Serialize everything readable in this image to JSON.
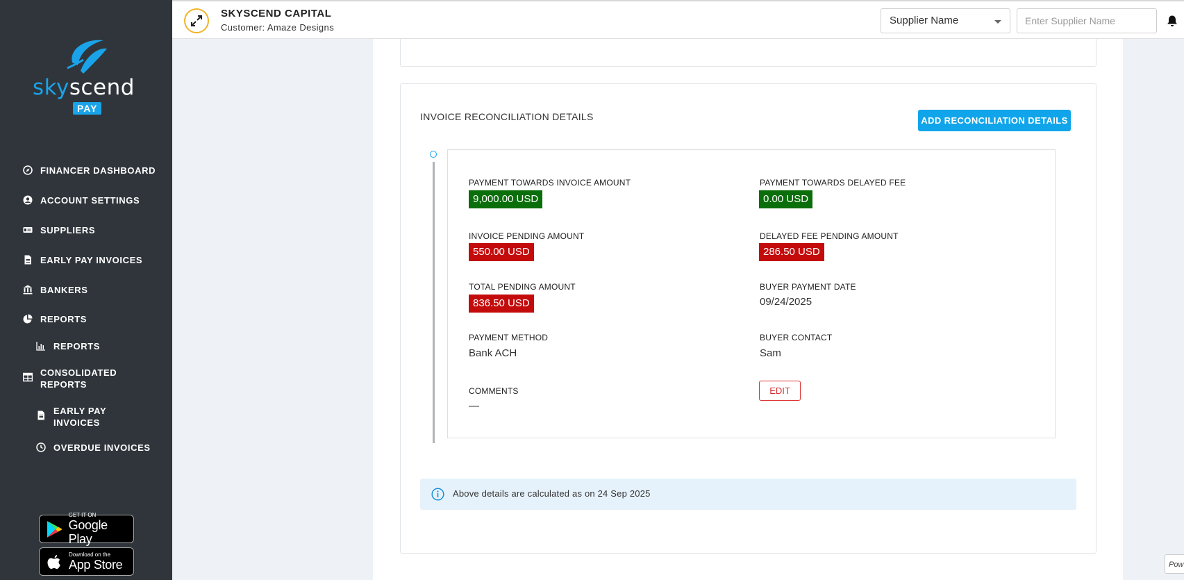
{
  "sidebar": {
    "logo": {
      "sky": "sky",
      "scend": "scend",
      "pay": "PAY"
    },
    "nav": [
      {
        "label": "FINANCER DASHBOARD",
        "icon": "compass-icon"
      },
      {
        "label": "ACCOUNT SETTINGS",
        "icon": "user-circle-icon"
      },
      {
        "label": "SUPPLIERS",
        "icon": "id-card-icon"
      },
      {
        "label": "EARLY PAY INVOICES",
        "icon": "document-icon"
      },
      {
        "label": "BANKERS",
        "icon": "bank-icon"
      },
      {
        "label": "REPORTS",
        "icon": "pie-chart-icon"
      },
      {
        "label": "REPORTS",
        "icon": "bar-chart-icon"
      },
      {
        "label": "CONSOLIDATED REPORTS",
        "icon": "table-icon"
      },
      {
        "label": "EARLY PAY INVOICES",
        "icon": "document-icon"
      },
      {
        "label": "OVERDUE INVOICES",
        "icon": "clock-icon"
      }
    ],
    "google_play": {
      "small": "GET IT ON",
      "big": "Google Play"
    },
    "app_store": {
      "small": "Download on the",
      "big": "App Store"
    }
  },
  "header": {
    "company_name": "SKYSCEND CAPITAL",
    "customer": "Customer: Amaze Designs",
    "select_value": "Supplier Name",
    "search_placeholder": "Enter Supplier Name"
  },
  "reconciliation": {
    "title": "INVOICE RECONCILIATION DETAILS",
    "add_button": "ADD RECONCILIATION DETAILS",
    "fields": {
      "payment_invoice_label": "PAYMENT TOWARDS INVOICE AMOUNT",
      "payment_invoice_value": "9,000.00 USD",
      "payment_delayed_label": "PAYMENT TOWARDS DELAYED FEE",
      "payment_delayed_value": "0.00 USD",
      "invoice_pending_label": "INVOICE PENDING AMOUNT",
      "invoice_pending_value": "550.00 USD",
      "delayed_pending_label": "DELAYED FEE PENDING AMOUNT",
      "delayed_pending_value": "286.50 USD",
      "total_pending_label": "TOTAL PENDING AMOUNT",
      "total_pending_value": "836.50 USD",
      "buyer_payment_date_label": "BUYER PAYMENT DATE",
      "buyer_payment_date_value": "09/24/2025",
      "payment_method_label": "PAYMENT METHOD",
      "payment_method_value": "Bank ACH",
      "buyer_contact_label": "BUYER CONTACT",
      "buyer_contact_value": "Sam",
      "comments_label": "COMMENTS",
      "comments_value": "—"
    },
    "edit_button": "EDIT",
    "info_text": "Above details are calculated as on 24 Sep 2025"
  },
  "footer_tab": "Pow",
  "colors": {
    "sidebar_bg": "#2f353b",
    "accent": "#10a5ea",
    "badge_green": "#0a6e0a",
    "badge_red": "#c40b0b"
  }
}
